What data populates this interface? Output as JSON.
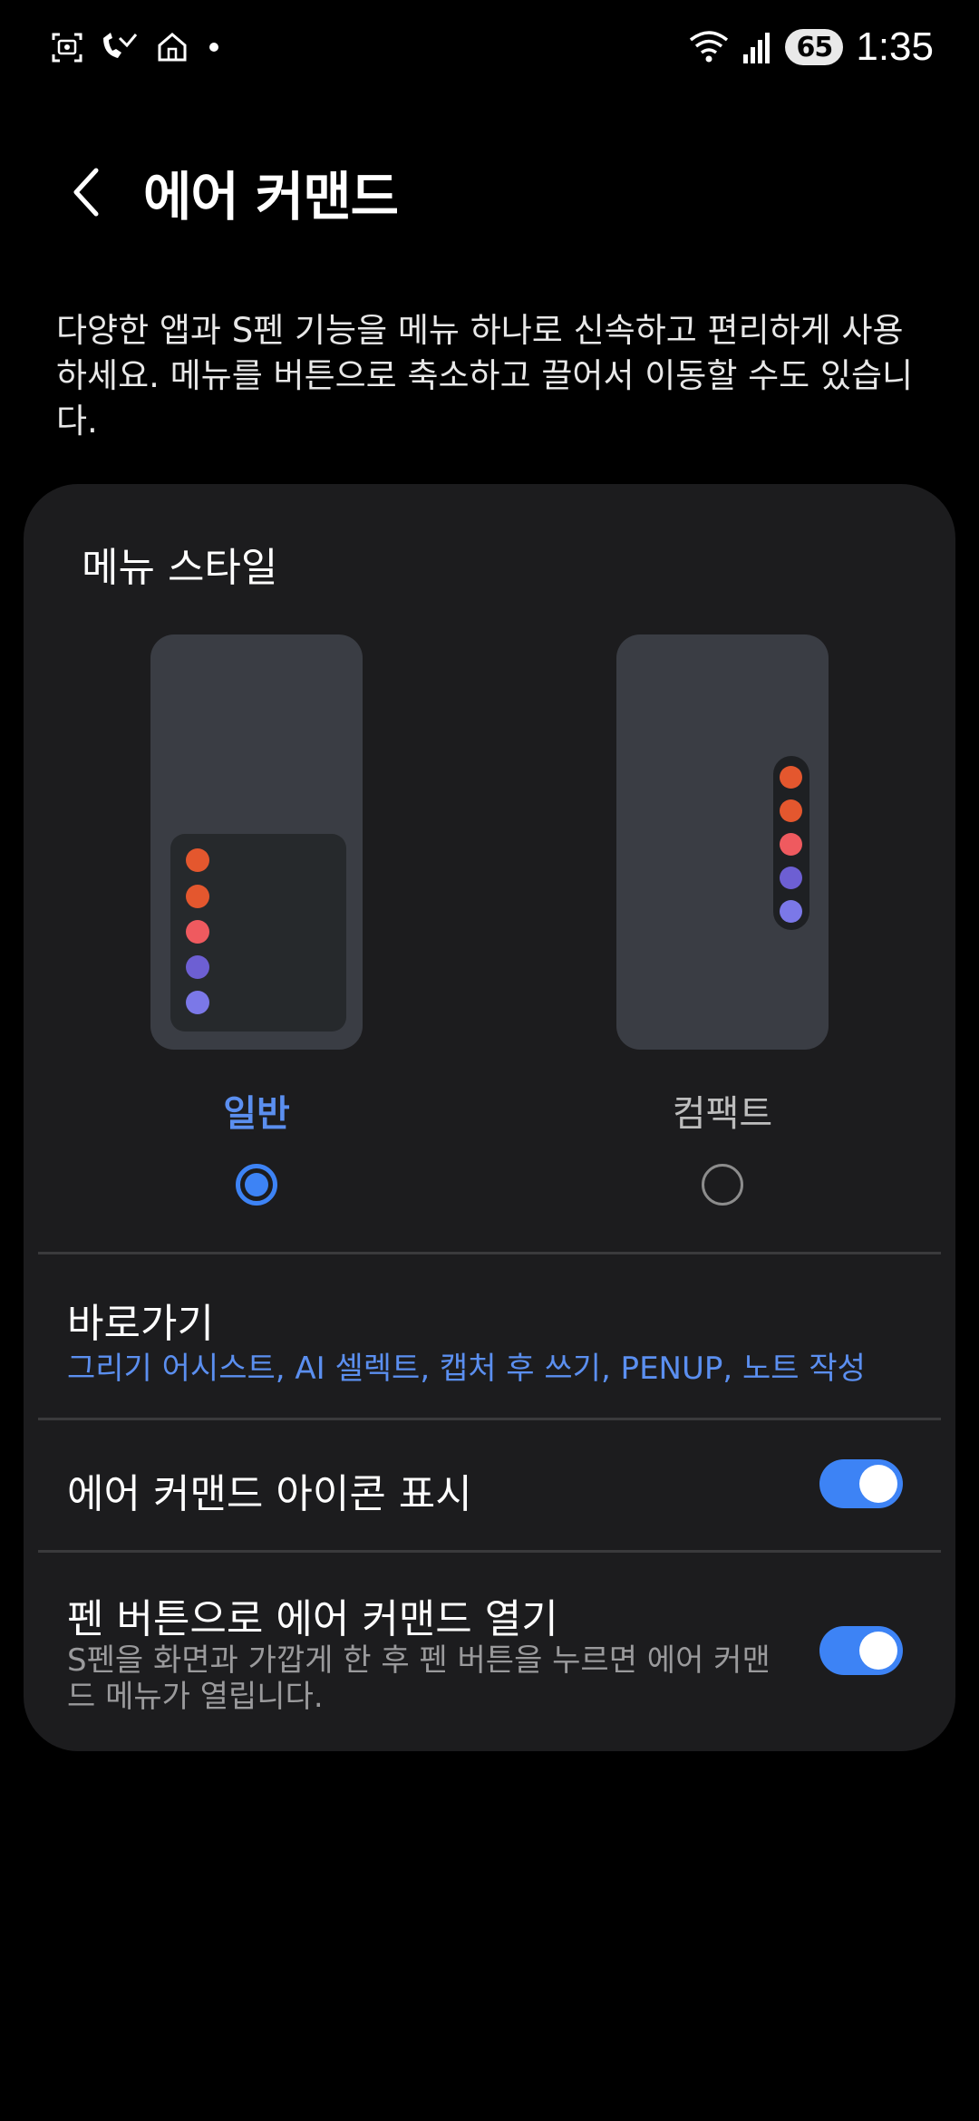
{
  "status_bar": {
    "left_icons": [
      "screenshot-icon",
      "missed-call-icon",
      "home-icon",
      "notification-dot-icon"
    ],
    "right_icons": [
      "wifi-icon",
      "signal-icon"
    ],
    "battery": "65",
    "time": "1:35"
  },
  "header": {
    "back_icon": "chevron-left-icon",
    "title": "에어 커맨드"
  },
  "description": "다양한 앱과 S펜 기능을 메뉴 하나로 신속하고 편리하게 사용하세요. 메뉴를 버튼으로 축소하고 끌어서 이동할 수도 있습니다.",
  "menu_style": {
    "title": "메뉴 스타일",
    "options": [
      {
        "label": "일반",
        "selected": true
      },
      {
        "label": "컴팩트",
        "selected": false
      }
    ],
    "dot_colors": [
      "#e4572e",
      "#e4572e",
      "#ef5a5f",
      "#6d5fd3",
      "#7b78e8"
    ]
  },
  "shortcuts": {
    "title": "바로가기",
    "subtitle": "그리기 어시스트, AI 셀렉트, 캡처 후 쓰기, PENUP, 노트 작성"
  },
  "show_icon": {
    "title": "에어 커맨드 아이콘 표시",
    "enabled": true
  },
  "pen_button": {
    "title": "펜 버튼으로 에어 커맨드 열기",
    "subtitle": "S펜을 화면과 가깝게 한 후 펜 버튼을 누르면 에어 커맨드 메뉴가 열립니다.",
    "enabled": true
  },
  "colors": {
    "accent": "#3d83f5",
    "card": "#1c1c1e",
    "background": "#000000"
  }
}
